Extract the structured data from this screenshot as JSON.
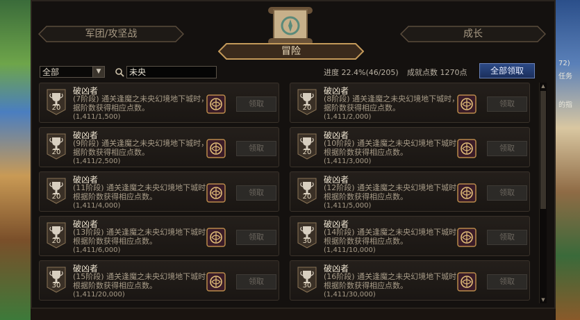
{
  "background": {
    "right_snippets": [
      "72)",
      "任务",
      "的指"
    ]
  },
  "tabs": {
    "legion": "军团/攻坚战",
    "adventure": "冒险",
    "growth": "成长"
  },
  "filter": {
    "selected": "全部"
  },
  "search": {
    "value": "未央"
  },
  "stats": {
    "progress": "进度  22.4%(46/205)",
    "points": "成就点数 1270点"
  },
  "claim_all_label": "全部领取",
  "achievements": [
    {
      "title": "破凶者",
      "level": "20",
      "desc": "(7阶段) 通关逢魔之未央幻境地下城时，根据阶数获得相应点数。",
      "progress": "(1,411/1,500)",
      "button": "领取"
    },
    {
      "title": "破凶者",
      "level": "20",
      "desc": "(8阶段) 通关逢魔之未央幻境地下城时，根据阶数获得相应点数。",
      "progress": "(1,411/2,000)",
      "button": "领取"
    },
    {
      "title": "破凶者",
      "level": "20",
      "desc": "(9阶段) 通关逢魔之未央幻境地下城时，根据阶数获得相应点数。",
      "progress": "(1,411/2,500)",
      "button": "领取"
    },
    {
      "title": "破凶者",
      "level": "20",
      "desc": "(10阶段) 通关逢魔之未央幻境地下城时，根据阶数获得相应点数。",
      "progress": "(1,411/3,000)",
      "button": "领取"
    },
    {
      "title": "破凶者",
      "level": "20",
      "desc": "(11阶段) 通关逢魔之未央幻境地下城时，根据阶数获得相应点数。",
      "progress": "(1,411/4,000)",
      "button": "领取"
    },
    {
      "title": "破凶者",
      "level": "20",
      "desc": "(12阶段) 通关逢魔之未央幻境地下城时，根据阶数获得相应点数。",
      "progress": "(1,411/5,000)",
      "button": "领取"
    },
    {
      "title": "破凶者",
      "level": "20",
      "desc": "(13阶段) 通关逢魔之未央幻境地下城时，根据阶数获得相应点数。",
      "progress": "(1,411/6,000)",
      "button": "领取"
    },
    {
      "title": "破凶者",
      "level": "30",
      "desc": "(14阶段) 通关逢魔之未央幻境地下城时，根据阶数获得相应点数。",
      "progress": "(1,411/10,000)",
      "button": "领取"
    },
    {
      "title": "破凶者",
      "level": "30",
      "desc": "(15阶段) 通关逢魔之未央幻境地下城时，根据阶数获得相应点数。",
      "progress": "(1,411/20,000)",
      "button": "领取"
    },
    {
      "title": "破凶者",
      "level": "30",
      "desc": "(16阶段) 通关逢魔之未央幻境地下城时，根据阶数获得相应点数。",
      "progress": "(1,411/30,000)",
      "button": "领取"
    }
  ]
}
